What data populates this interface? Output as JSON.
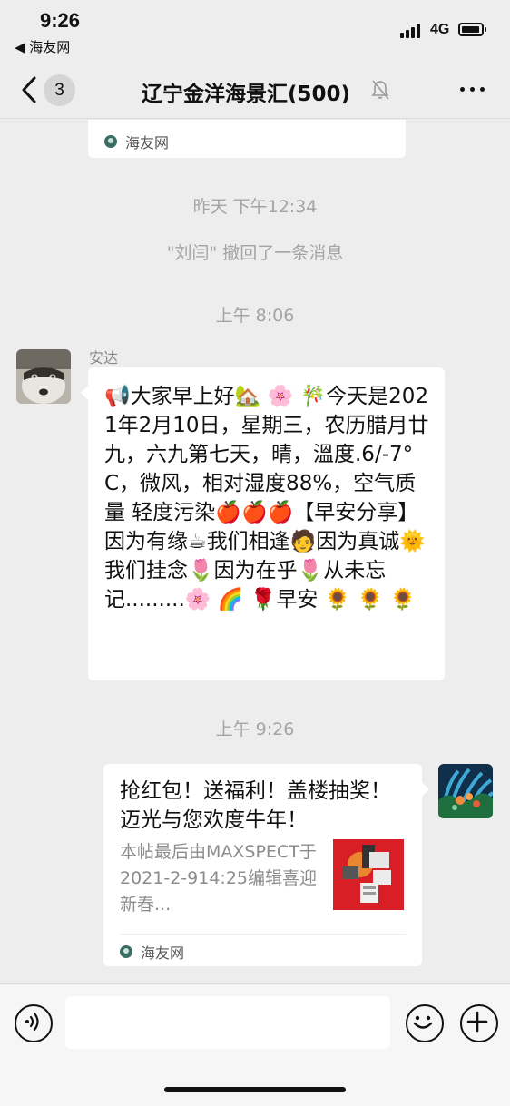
{
  "status_bar": {
    "time": "9:26",
    "back_app": "◀ 海友网",
    "network": "4G"
  },
  "nav": {
    "unread_count": "3",
    "title": "辽宁金洋海景汇(500)"
  },
  "messages": {
    "prev_card_source": "海友网",
    "timestamp_yesterday": "昨天 下午12:34",
    "recall_notice": "\"刘闫\" 撤回了一条消息",
    "timestamp_morning": "上午 8:06",
    "sender_name": "安达",
    "greeting_text": "📢大家早上好🏡 🌸 🎋今天是2021年2月10日，星期三，农历腊月廿九，六九第七天，晴，溫度.6/-7°C，微风，相对湿度88%，空气质量  轻度污染🍎🍎🍎【早安分享】因为有缘☕我们相逢🧑因为真诚🌞我们挂念🌷因为在乎🌷从未忘记.........🌸 🌈 🌹早安  🌻 🌻 🌻",
    "timestamp_latest": "上午 9:26",
    "card_title": "抢红包！送福利！盖楼抽奖！迈光与您欢度牛年！",
    "card_desc": "本帖最后由MAXSPECT于2021-2-914:25编辑喜迎新春...",
    "card_source": "海友网"
  },
  "input": {
    "placeholder": ""
  },
  "colors": {
    "background": "#ededed",
    "bubble": "#ffffff",
    "muted_text": "#a4a4a4"
  }
}
